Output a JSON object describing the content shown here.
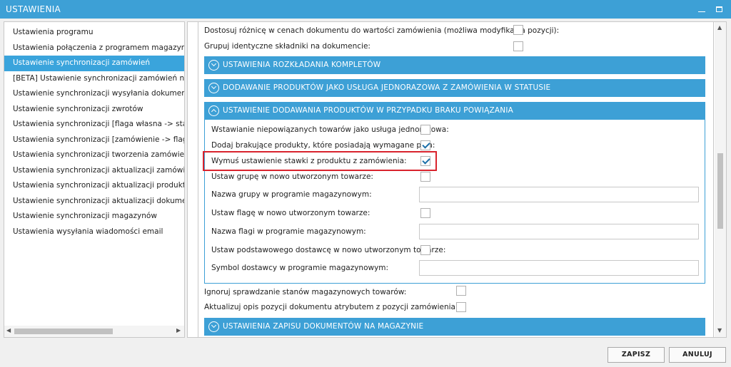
{
  "window": {
    "title": "USTAWIENIA"
  },
  "sidebar": {
    "items": [
      "Ustawienia programu",
      "Ustawienia połączenia z programem magazynowym",
      "Ustawienie synchronizacji zamówień",
      "[BETA] Ustawienie synchronizacji zamówień na podsta",
      "Ustawienie synchronizacji wysyłania dokumentów",
      "Ustawienie synchronizacji zwrotów",
      "Ustawienia synchronizacji [flaga własna -> status]",
      "Ustawienia synchronizacji [zamówienie -> flaga własn",
      "Ustawienia synchronizacji tworzenia zamówień w Base",
      "Ustawienia synchronizacji aktualizacji zamówień w Bas",
      "Ustawienia synchronizacji aktualizacji produktów w Ba",
      "Ustawienie synchronizacji aktualizacji dokumentów",
      "Ustawienie synchronizacji magazynów",
      "Ustawienia wysyłania wiadomości email"
    ],
    "selected_index": 2
  },
  "main": {
    "top_rows": [
      {
        "label": "Dostosuj różnicę w cenach dokumentu do wartości zamówienia (możliwa modyfikacja pozycji):",
        "checked": false
      },
      {
        "label": "Grupuj identyczne składniki na dokumencie:",
        "checked": false
      }
    ],
    "sections": [
      {
        "label": "USTAWIENIA ROZKŁADANIA KOMPLETÓW",
        "expanded": false
      },
      {
        "label": "DODAWANIE PRODUKTÓW JAKO USŁUGA JEDNORAZOWA Z ZAMÓWIENIA W STATUSIE",
        "expanded": false
      },
      {
        "label": "USTAWIENIE DODAWANIA PRODUKTÓW W PRZYPADKU BRAKU POWIĄZANIA",
        "expanded": true
      },
      {
        "label": "USTAWIENIA ZAPISU DOKUMENTÓW NA MAGAZYNIE",
        "expanded": false
      }
    ],
    "expanded_rows": [
      {
        "label": "Wstawianie niepowiązanych towarów jako usługa jednorazowa:",
        "checked": false
      },
      {
        "label": "Dodaj brakujące produkty, które posiadają wymagane pola:",
        "checked": true
      },
      {
        "label": "Wymuś ustawienie stawki z produktu z zamówienia:",
        "checked": true
      },
      {
        "label": "Ustaw grupę w nowo utworzonym towarze:",
        "checked": false
      },
      {
        "label": "Nazwa grupy w programie magazynowym:",
        "value": ""
      },
      {
        "label": "Ustaw flagę w nowo utworzonym towarze:",
        "checked": false
      },
      {
        "label": "Nazwa flagi w programie magazynowym:",
        "value": ""
      },
      {
        "label": "Ustaw podstawowego dostawcę w nowo utworzonym towarze:",
        "checked": false
      },
      {
        "label": "Symbol dostawcy w programie magazynowym:",
        "value": ""
      }
    ],
    "after_rows": [
      {
        "label": "Ignoruj sprawdzanie stanów magazynowych towarów:",
        "checked": false
      },
      {
        "label": "Aktualizuj opis pozycji dokumentu atrybutem z pozycji zamówienia:",
        "checked": false
      }
    ]
  },
  "buttons": {
    "save": "ZAPISZ",
    "cancel": "ANULUJ"
  },
  "colors": {
    "accent": "#3da0d6",
    "highlight": "#d9232d",
    "check": "#1c6fa8"
  },
  "icons": {
    "minimize": "minimize-icon",
    "maximize": "maximize-icon",
    "section_toggle": "chevron-circle-icon"
  }
}
